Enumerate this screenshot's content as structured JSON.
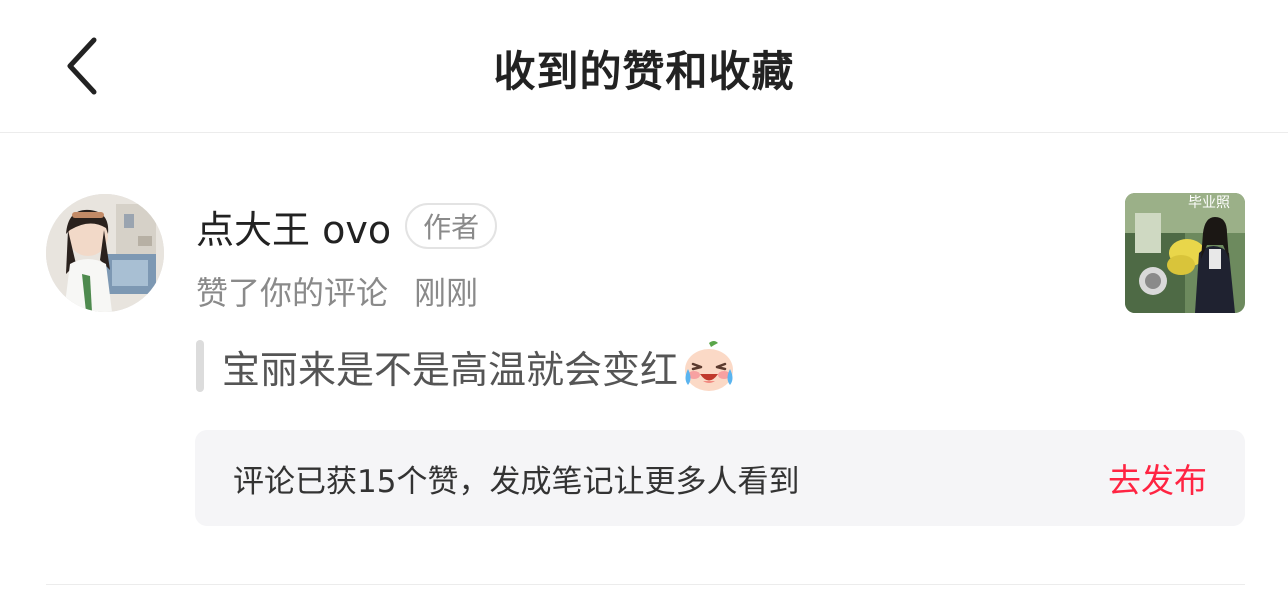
{
  "header": {
    "title": "收到的赞和收藏",
    "back_icon": "chevron-left-icon"
  },
  "notification": {
    "username": "点大王 ovo",
    "badge": "作者",
    "action": "赞了你的评论",
    "time": "刚刚",
    "comment_text": "宝丽来是不是高温就会变红",
    "emoji": "crying-laughing-emoji",
    "thumbnail_text": "毕业照",
    "prompt_text": "评论已获15个赞，发成笔记让更多人看到",
    "publish_label": "去发布"
  },
  "colors": {
    "accent": "#ff2442",
    "muted_text": "#8a8a8a",
    "prompt_bg": "#f5f5f7"
  }
}
